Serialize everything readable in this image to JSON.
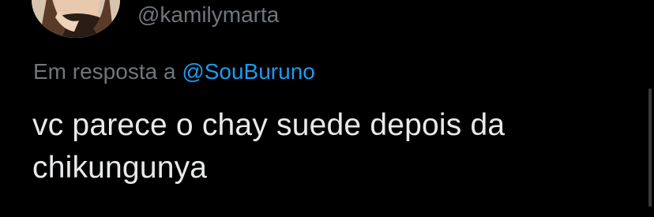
{
  "tweet": {
    "author_handle": "@kamilymarta",
    "avatar_icon": "user-avatar-photo",
    "reply_prefix": "Em resposta a",
    "reply_to": "@SouBuruno",
    "text": "vc parece o chay suede depois da chikungunya"
  },
  "colors": {
    "background": "#000000",
    "text": "#e7e9ea",
    "secondary": "#71767b",
    "mention": "#1d9bf0"
  }
}
